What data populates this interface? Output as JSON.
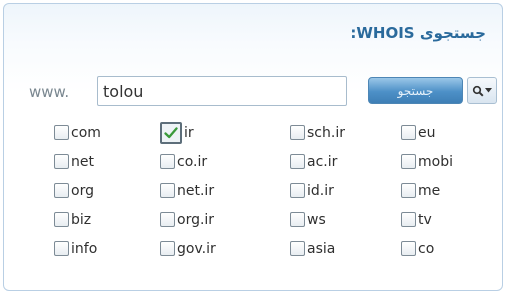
{
  "title": "جستجوی WHOIS:",
  "search": {
    "prefix": "www.",
    "value": "tolou",
    "button_label": "جستجو"
  },
  "tlds": [
    {
      "label": "com",
      "checked": false
    },
    {
      "label": "ir",
      "checked": true
    },
    {
      "label": "sch.ir",
      "checked": false
    },
    {
      "label": "eu",
      "checked": false
    },
    {
      "label": "net",
      "checked": false
    },
    {
      "label": "co.ir",
      "checked": false
    },
    {
      "label": "ac.ir",
      "checked": false
    },
    {
      "label": "mobi",
      "checked": false
    },
    {
      "label": "org",
      "checked": false
    },
    {
      "label": "net.ir",
      "checked": false
    },
    {
      "label": "id.ir",
      "checked": false
    },
    {
      "label": "me",
      "checked": false
    },
    {
      "label": "biz",
      "checked": false
    },
    {
      "label": "org.ir",
      "checked": false
    },
    {
      "label": "ws",
      "checked": false
    },
    {
      "label": "tv",
      "checked": false
    },
    {
      "label": "info",
      "checked": false
    },
    {
      "label": "gov.ir",
      "checked": false
    },
    {
      "label": "asia",
      "checked": false
    },
    {
      "label": "co",
      "checked": false
    }
  ],
  "icons": {
    "search_dropdown": "search-icon",
    "checked_mark": "checkmark-icon"
  },
  "colors": {
    "title": "#2a6a9c",
    "button": "#4d90c7",
    "panel_border": "#b9cfe4",
    "check": "#3a9a3a"
  }
}
